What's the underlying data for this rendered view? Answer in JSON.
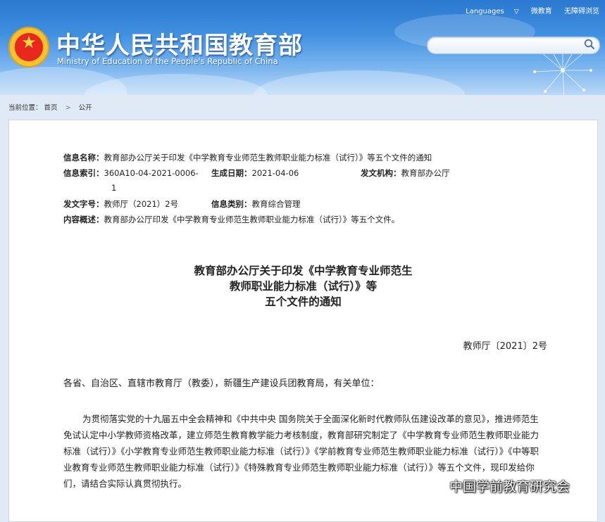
{
  "top_links": {
    "languages": "Languages",
    "weibo": "微教育",
    "accessible": "无障碍浏览"
  },
  "site": {
    "title_cn": "中华人民共和国教育部",
    "title_en": "Ministry of Education of the People's Republic of China"
  },
  "search": {
    "placeholder": ""
  },
  "breadcrumb": {
    "current_label": "当前位置：",
    "home": "首页",
    "sep": ">",
    "section": "公开"
  },
  "meta": {
    "name_label": "信息名称：",
    "name_value": "教育部办公厅关于印发《中学教育专业师范生教师职业能力标准（试行）》等五个文件的通知",
    "index_label": "信息索引：",
    "index_value_line1": "360A10-04-2021-0006-",
    "index_value_line2": "1",
    "date_label": "生成日期：",
    "date_value": "2021-04-06",
    "org_label": "发文机构：",
    "org_value": "教育部办公厅",
    "docno_label": "发文字号：",
    "docno_value": "教师厅（2021）2号",
    "category_label": "信息类别：",
    "category_value": "教育综合管理",
    "summary_label": "内容概述：",
    "summary_value": "教育部办公厅印发《中学教育专业师范生教师职业能力标准（试行）》等五个文件。"
  },
  "document": {
    "title_line1": "教育部办公厅关于印发《中学教育专业师范生",
    "title_line2": "教师职业能力标准（试行）》等",
    "title_line3": "五个文件的通知",
    "number": "教师厅〔2021〕2号",
    "addressee": "各省、自治区、直辖市教育厅（教委），新疆生产建设兵团教育局，有关单位：",
    "body": "为贯彻落实党的十九届五中全会精神和《中共中央 国务院关于全面深化新时代教师队伍建设改革的意见》，推进师范生免试认定中小学教师资格改革，建立师范生教育教学能力考核制度，教育部研究制定了《中学教育专业师范生教师职业能力标准（试行）》《小学教育专业师范生教师职业能力标准（试行）》《学前教育专业师范生教师职业能力标准（试行）》《中等职业教育专业师范生教师职业能力标准（试行）》《特殊教育专业师范生教师职业能力标准（试行）》等五个文件，现印发给你们，请结合实际认真贯彻执行。"
  },
  "watermark": {
    "text": "中国学前教育研究会"
  },
  "colors": {
    "header_top": "#2b78d0",
    "header_bottom": "#b9d8f6",
    "page_bg": "#dfeaf6"
  }
}
